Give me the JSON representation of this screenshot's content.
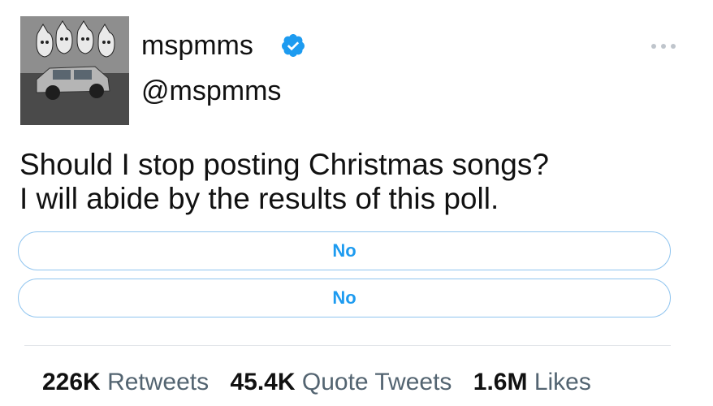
{
  "user": {
    "display_name": "mspmms",
    "handle": "@mspmms",
    "verified_icon": "verified-badge-icon",
    "avatar_icon": "profile-avatar"
  },
  "tweet": {
    "text_line_1": "Should I stop posting Christmas songs?",
    "text_line_2": "I will abide by the results of this poll."
  },
  "poll": {
    "options": [
      {
        "label": "No"
      },
      {
        "label": "No"
      }
    ]
  },
  "stats": {
    "retweets_count": "226K",
    "retweets_label": "Retweets",
    "quote_tweets_count": "45.4K",
    "quote_tweets_label": "Quote Tweets",
    "likes_count": "1.6M",
    "likes_label": "Likes"
  },
  "colors": {
    "accent": "#1d9bf0",
    "poll_border": "#8fc4ef",
    "text": "#111111",
    "secondary_text": "#536471"
  }
}
